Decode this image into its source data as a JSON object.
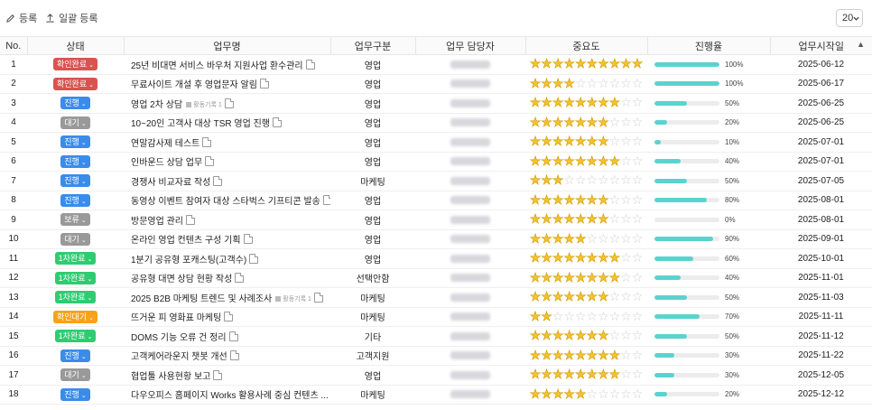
{
  "toolbar": {
    "register": "등록",
    "bulk_register": "일괄 등록",
    "page_size": "20"
  },
  "columns": [
    "No.",
    "상태",
    "업무명",
    "업무구분",
    "업무 담당자",
    "중요도",
    "진행율",
    "업무시작일"
  ],
  "status_colors": {
    "확인완료": "#d9534f",
    "진행": "#3b8beb",
    "대기": "#999999",
    "보류": "#999999",
    "1차완료": "#2ecc71",
    "확인대기": "#f7a21b"
  },
  "rows": [
    {
      "no": "1",
      "status": "확인완료",
      "title": "25년 비대면 서비스 바우처 지원사업 환수관리",
      "activity": "",
      "category": "영업",
      "stars": 10,
      "progress": 100,
      "pct": "100%",
      "start": "2025-06-12"
    },
    {
      "no": "2",
      "status": "확인완료",
      "title": "무료사이트 개설 후 영업문자 알림",
      "activity": "",
      "category": "영업",
      "stars": 4,
      "progress": 100,
      "pct": "100%",
      "start": "2025-06-17"
    },
    {
      "no": "3",
      "status": "진행",
      "title": "영업 2차 상담",
      "activity": "활동기록 1",
      "category": "영업",
      "stars": 8,
      "progress": 50,
      "pct": "50%",
      "start": "2025-06-25"
    },
    {
      "no": "4",
      "status": "대기",
      "title": "10~20인 고객사 대상 TSR 영업 진행",
      "activity": "",
      "category": "영업",
      "stars": 7,
      "progress": 20,
      "pct": "20%",
      "start": "2025-06-25"
    },
    {
      "no": "5",
      "status": "진행",
      "title": "연말감사제 테스트",
      "activity": "",
      "category": "영업",
      "stars": 7,
      "progress": 10,
      "pct": "10%",
      "start": "2025-07-01"
    },
    {
      "no": "6",
      "status": "진행",
      "title": "인바운드 상담 업무",
      "activity": "",
      "category": "영업",
      "stars": 8,
      "progress": 40,
      "pct": "40%",
      "start": "2025-07-01"
    },
    {
      "no": "7",
      "status": "진행",
      "title": "경쟁사 비교자료 작성",
      "activity": "",
      "category": "마케팅",
      "stars": 3,
      "progress": 50,
      "pct": "50%",
      "start": "2025-07-05"
    },
    {
      "no": "8",
      "status": "진행",
      "title": "동영상 이벤트 참여자 대상 스타벅스 기프티콘 발송",
      "activity": "",
      "category": "영업",
      "stars": 7,
      "progress": 80,
      "pct": "80%",
      "start": "2025-08-01"
    },
    {
      "no": "9",
      "status": "보류",
      "title": "방문영업 관리",
      "activity": "",
      "category": "영업",
      "stars": 7,
      "progress": 0,
      "pct": "0%",
      "start": "2025-08-01"
    },
    {
      "no": "10",
      "status": "대기",
      "title": "온라인 영업 컨텐츠 구성 기획",
      "activity": "",
      "category": "영업",
      "stars": 5,
      "progress": 90,
      "pct": "90%",
      "start": "2025-09-01"
    },
    {
      "no": "11",
      "status": "1차완료",
      "title": "1분기 공유형 포캐스팅(고객수)",
      "activity": "",
      "category": "영업",
      "stars": 8,
      "progress": 60,
      "pct": "60%",
      "start": "2025-10-01"
    },
    {
      "no": "12",
      "status": "1차완료",
      "title": "공유형 대면 상담 현황 작성",
      "activity": "",
      "category": "선택안함",
      "stars": 8,
      "progress": 40,
      "pct": "40%",
      "start": "2025-11-01"
    },
    {
      "no": "13",
      "status": "1차완료",
      "title": "2025 B2B 마케팅 트렌드 및 사례조사",
      "activity": "활동기록 1",
      "category": "마케팅",
      "stars": 7,
      "progress": 50,
      "pct": "50%",
      "start": "2025-11-03"
    },
    {
      "no": "14",
      "status": "확인대기",
      "title": "뜨거운 피 영화표 마케팅",
      "activity": "",
      "category": "마케팅",
      "stars": 2,
      "progress": 70,
      "pct": "70%",
      "start": "2025-11-11"
    },
    {
      "no": "15",
      "status": "1차완료",
      "title": "DOMS 기능 오류 건 정리",
      "activity": "",
      "category": "기타",
      "stars": 7,
      "progress": 50,
      "pct": "50%",
      "start": "2025-11-12"
    },
    {
      "no": "16",
      "status": "진행",
      "title": "고객케어라운지 챗봇 개선",
      "activity": "",
      "category": "고객지원",
      "stars": 8,
      "progress": 30,
      "pct": "30%",
      "start": "2025-11-22"
    },
    {
      "no": "17",
      "status": "대기",
      "title": "협업툴 사용현황 보고",
      "activity": "",
      "category": "영업",
      "stars": 8,
      "progress": 30,
      "pct": "30%",
      "start": "2025-12-05"
    },
    {
      "no": "18",
      "status": "진행",
      "title": "다우오피스 홈페이지 Works 활용사례 중심 컨텐츠 ...",
      "activity": "",
      "category": "마케팅",
      "stars": 5,
      "progress": 20,
      "pct": "20%",
      "start": "2025-12-12"
    }
  ]
}
